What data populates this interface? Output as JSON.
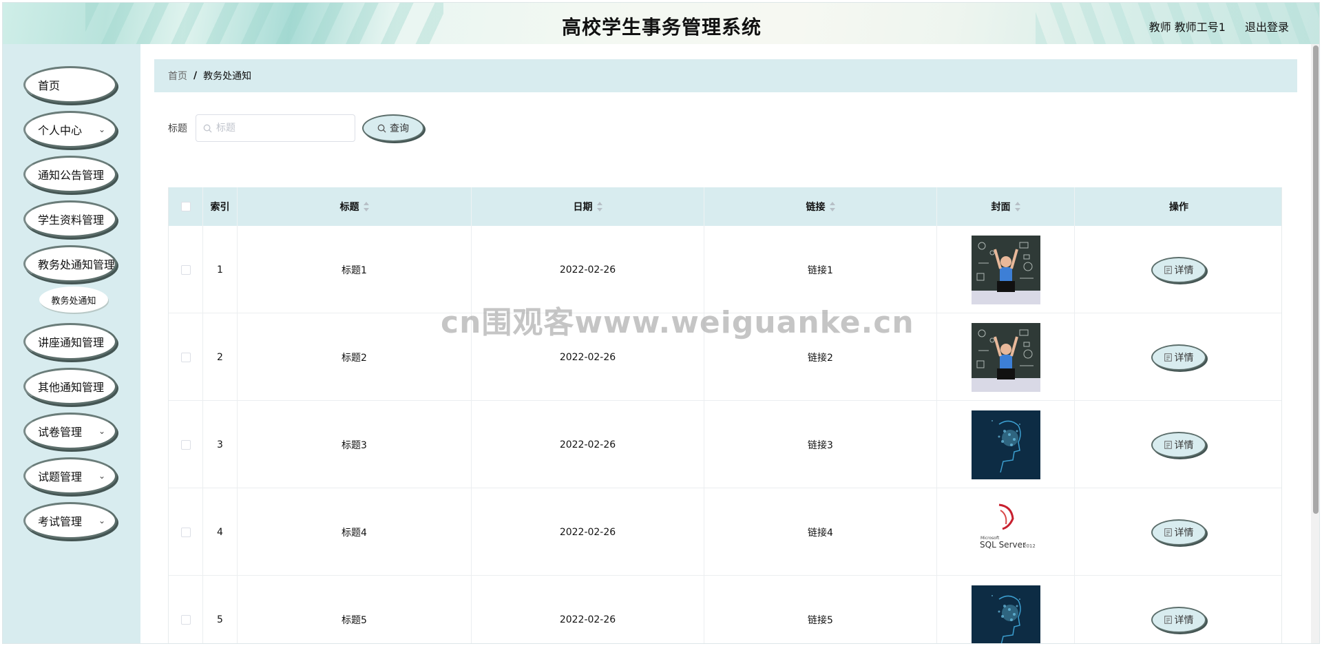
{
  "header": {
    "title": "高校学生事务管理系统",
    "user": "教师 教师工号1",
    "logout": "退出登录"
  },
  "sidebar": {
    "items": [
      {
        "label": "首页",
        "has_submenu": false
      },
      {
        "label": "个人中心",
        "has_submenu": true
      },
      {
        "label": "通知公告管理",
        "has_submenu": false
      },
      {
        "label": "学生资料管理",
        "has_submenu": false
      },
      {
        "label": "教务处通知管理",
        "has_submenu": false
      },
      {
        "label": "讲座通知管理",
        "has_submenu": false
      },
      {
        "label": "其他通知管理",
        "has_submenu": false
      },
      {
        "label": "试卷管理",
        "has_submenu": true
      },
      {
        "label": "试题管理",
        "has_submenu": true
      },
      {
        "label": "考试管理",
        "has_submenu": true
      }
    ],
    "submenu_item": "教务处通知"
  },
  "breadcrumb": {
    "home": "首页",
    "separator": "/",
    "current": "教务处通知"
  },
  "search": {
    "label": "标题",
    "placeholder": "标题",
    "value": "",
    "button": "查询"
  },
  "table": {
    "columns": {
      "index": "索引",
      "title": "标题",
      "date": "日期",
      "link": "链接",
      "cover": "封面",
      "actions": "操作"
    },
    "rows": [
      {
        "index": "1",
        "title": "标题1",
        "date": "2022-02-26",
        "link": "链接1",
        "cover": "chalkboard-photo",
        "action": "详情"
      },
      {
        "index": "2",
        "title": "标题2",
        "date": "2022-02-26",
        "link": "链接2",
        "cover": "chalkboard-photo",
        "action": "详情"
      },
      {
        "index": "3",
        "title": "标题3",
        "date": "2022-02-26",
        "link": "链接3",
        "cover": "digital-head",
        "action": "详情"
      },
      {
        "index": "4",
        "title": "标题4",
        "date": "2022-02-26",
        "link": "链接4",
        "cover": "sql-server-logo",
        "action": "详情"
      },
      {
        "index": "5",
        "title": "标题5",
        "date": "2022-02-26",
        "link": "链接5",
        "cover": "digital-head",
        "action": "详情"
      }
    ]
  },
  "cover_images": {
    "sql-server-logo": {
      "brand": "Microsoft",
      "product": "SQL Server",
      "version": "2012"
    }
  },
  "watermark": "cn围观客www.weiguanke.cn",
  "colors": {
    "accent": "#d8ecef",
    "button_border": "#5c6e6b",
    "sidebar_bg": "#d8ecef"
  }
}
